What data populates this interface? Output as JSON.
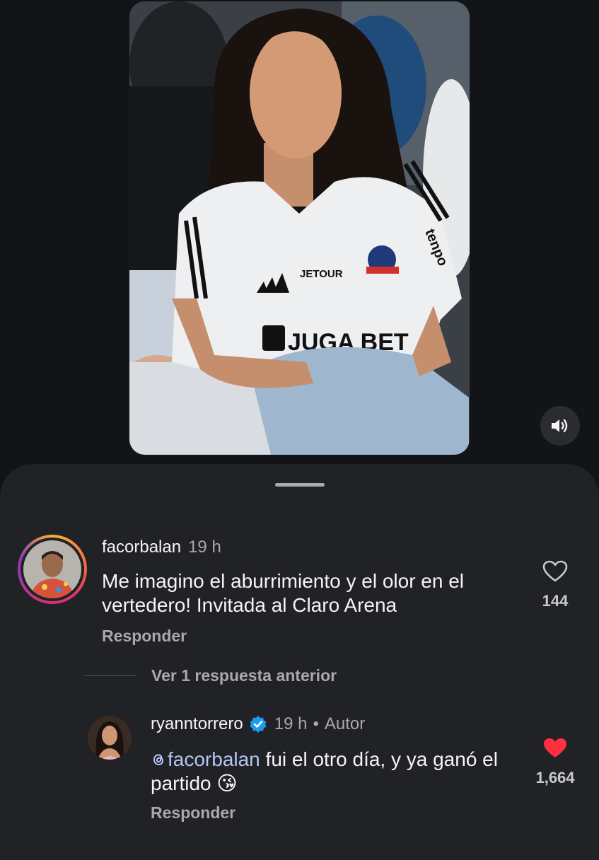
{
  "video": {
    "sound_button_icon": "speaker-on-icon",
    "jersey_sponsor_main": "JUGA BET",
    "jersey_sponsor_chest": "JETOUR",
    "jersey_sleeve": "tenpo",
    "jersey_club_badge": "COLO-COLO"
  },
  "comments": [
    {
      "username": "facorbalan",
      "time": "19 h",
      "text": "Me imagino el aburrimiento y el olor en el vertedero! Invitada al Claro Arena",
      "reply_label": "Responder",
      "likes": "144",
      "liked": false,
      "has_story_ring": true
    }
  ],
  "view_replies_label": "Ver 1 respuesta anterior",
  "replies": [
    {
      "username": "ryanntorrero",
      "verified": true,
      "time": "19 h",
      "separator": "•",
      "author_label": "Autor",
      "mention": "facorbalan",
      "text": " fui el otro día, y ya ganó el partido",
      "emoji": "😘",
      "reply_label": "Responder",
      "likes": "1,664",
      "liked": true
    }
  ],
  "colors": {
    "background": "#131417",
    "sheet": "#212226",
    "like_red": "#ff3040",
    "verified_blue": "#1d9bf0",
    "mention": "#b3c6f5"
  }
}
